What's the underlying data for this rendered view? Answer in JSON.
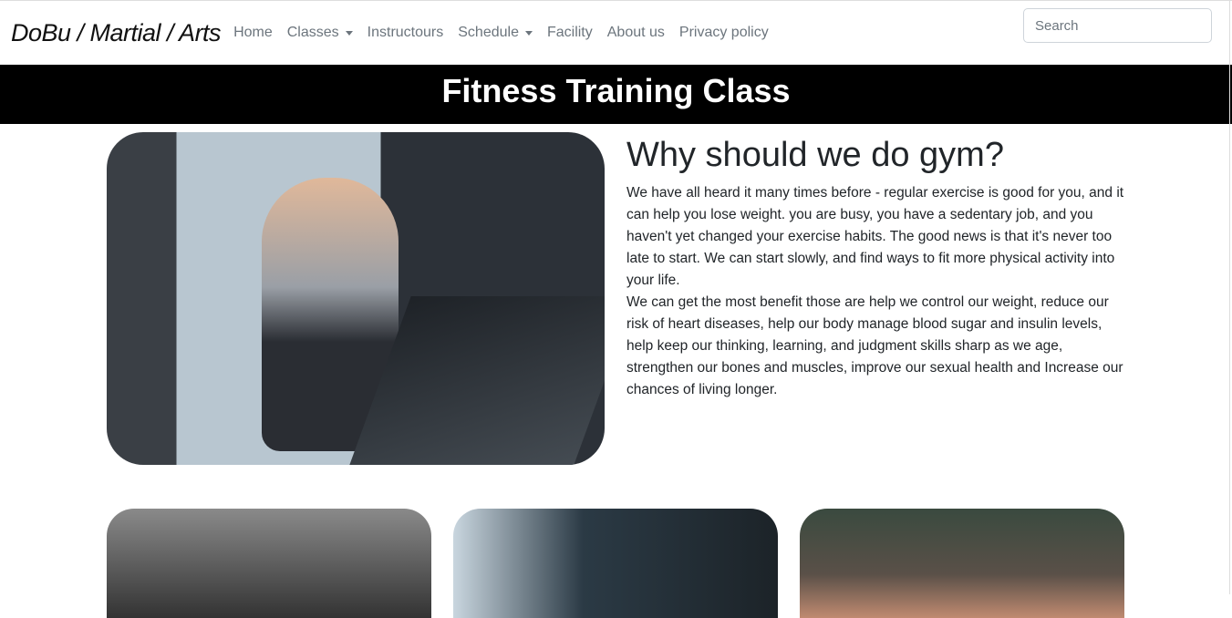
{
  "nav": {
    "brand": "DoBu / Martial / Arts",
    "links": [
      {
        "label": "Home"
      },
      {
        "label": "Classes",
        "dropdown": true
      },
      {
        "label": "Instructours"
      },
      {
        "label": "Schedule",
        "dropdown": true
      },
      {
        "label": "Facility"
      },
      {
        "label": "About us"
      },
      {
        "label": "Privacy policy"
      }
    ],
    "search_placeholder": "Search"
  },
  "banner": {
    "title": "Fitness Training Class"
  },
  "article": {
    "heading": "Why should we do gym?",
    "p1": "We have all heard it many times before - regular exercise is good for you, and it can help you lose weight. you are busy, you have a sedentary job, and you haven't yet changed your exercise habits. The good news is that it's never too late to start. We can start slowly, and find ways to fit more physical activity into your life.",
    "p2": "We can get the most benefit those are help we control our weight, reduce our risk of heart diseases, help our body manage blood sugar and insulin levels, help keep our thinking, learning, and judgment skills sharp as we age, strengthen our bones and muscles, improve our sexual health and Increase our chances of living longer."
  }
}
